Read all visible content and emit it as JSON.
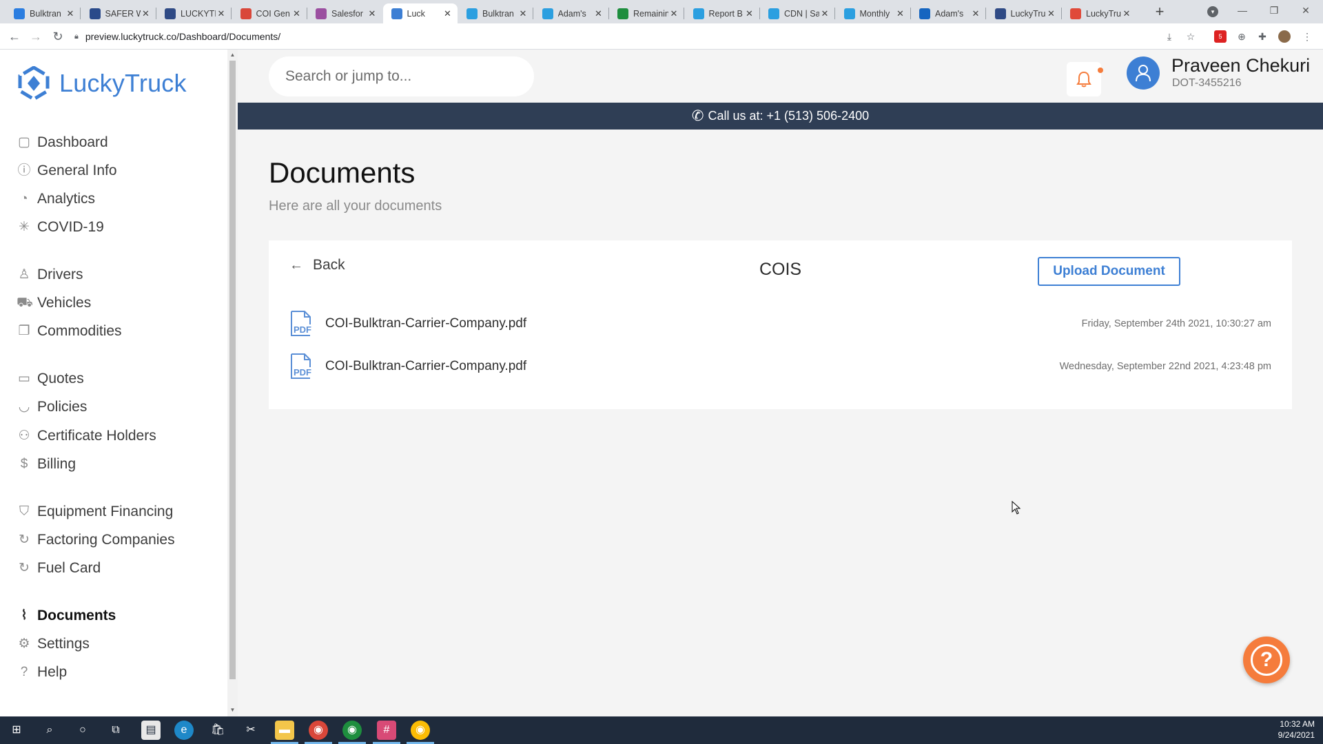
{
  "browser": {
    "tabs": [
      {
        "label": "Bulktran",
        "color": "#2b7de0",
        "active": false
      },
      {
        "label": "SAFER W",
        "color": "#2a4a8a",
        "active": false
      },
      {
        "label": "LUCKYTF",
        "color": "#2f4a85",
        "active": false
      },
      {
        "label": "COI Gen",
        "color": "#d9473a",
        "active": false
      },
      {
        "label": "Salesfor",
        "color": "#9b4fa0",
        "active": false
      },
      {
        "label": "Luck",
        "color": "#3d7fd4",
        "active": true
      },
      {
        "label": "Bulktran",
        "color": "#2b9fe0",
        "active": false
      },
      {
        "label": "Adam's",
        "color": "#2b9fe0",
        "active": false
      },
      {
        "label": "Remainin",
        "color": "#1e8e3e",
        "active": false
      },
      {
        "label": "Report B",
        "color": "#2b9fe0",
        "active": false
      },
      {
        "label": "CDN | Sa",
        "color": "#2b9fe0",
        "active": false
      },
      {
        "label": "Monthly",
        "color": "#2b9fe0",
        "active": false
      },
      {
        "label": "Adam's",
        "color": "#1565c0",
        "active": false
      },
      {
        "label": "LuckyTru",
        "color": "#2f4a85",
        "active": false
      },
      {
        "label": "LuckyTru",
        "color": "#e04a3a",
        "active": false
      }
    ],
    "url": "preview.luckytruck.co/Dashboard/Documents/"
  },
  "sidebar": {
    "logo_text": "LuckyTruck",
    "items": [
      {
        "label": "Dashboard",
        "icon": "layout-icon",
        "glyph": "▢",
        "active": false
      },
      {
        "label": "General Info",
        "icon": "info-icon",
        "glyph": "ⓘ",
        "active": false
      },
      {
        "label": "Analytics",
        "icon": "pie-chart-icon",
        "glyph": "◔",
        "active": false
      },
      {
        "label": "COVID-19",
        "icon": "loader-icon",
        "glyph": "✳",
        "active": false
      },
      {
        "label": "Drivers",
        "icon": "user-icon",
        "glyph": "♙",
        "active": false
      },
      {
        "label": "Vehicles",
        "icon": "truck-icon",
        "glyph": "⛟",
        "active": false
      },
      {
        "label": "Commodities",
        "icon": "copy-icon",
        "glyph": "❐",
        "active": false
      },
      {
        "label": "Quotes",
        "icon": "message-square-icon",
        "glyph": "▭",
        "active": false
      },
      {
        "label": "Policies",
        "icon": "pocket-icon",
        "glyph": "◡",
        "active": false
      },
      {
        "label": "Certificate Holders",
        "icon": "award-icon",
        "glyph": "⚇",
        "active": false
      },
      {
        "label": "Billing",
        "icon": "dollar-sign-icon",
        "glyph": "$",
        "active": false
      },
      {
        "label": "Equipment Financing",
        "icon": "shield-icon",
        "glyph": "⛉",
        "active": false
      },
      {
        "label": "Factoring Companies",
        "icon": "refresh-icon",
        "glyph": "↻",
        "active": false
      },
      {
        "label": "Fuel Card",
        "icon": "refresh-icon",
        "glyph": "↻",
        "active": false
      },
      {
        "label": "Documents",
        "icon": "paperclip-icon",
        "glyph": "⌇",
        "active": true
      },
      {
        "label": "Settings",
        "icon": "settings-icon",
        "glyph": "⚙",
        "active": false
      },
      {
        "label": "Help",
        "icon": "help-circle-icon",
        "glyph": "?",
        "active": false
      }
    ]
  },
  "header": {
    "search_placeholder": "Search or jump to...",
    "user_name": "Praveen Chekuri",
    "user_dot": "DOT-3455216",
    "call_text": "Call us at: +1 (513) 506-2400"
  },
  "page": {
    "title": "Documents",
    "subtitle": "Here are all your documents",
    "back_label": "Back",
    "folder_title": "COIS",
    "upload_label": "Upload Document",
    "documents": [
      {
        "name": "COI-Bulktran-Carrier-Company.pdf",
        "date": "Friday, September 24th 2021, 10:30:27 am"
      },
      {
        "name": "COI-Bulktran-Carrier-Company.pdf",
        "date": "Wednesday, September 22nd 2021, 4:23:48 pm"
      }
    ]
  },
  "taskbar": {
    "time": "10:32 AM",
    "date": "9/24/2021"
  },
  "colors": {
    "brand": "#3d7fd4",
    "callbar": "#2f3e55",
    "accent_orange": "#f57c3c"
  }
}
